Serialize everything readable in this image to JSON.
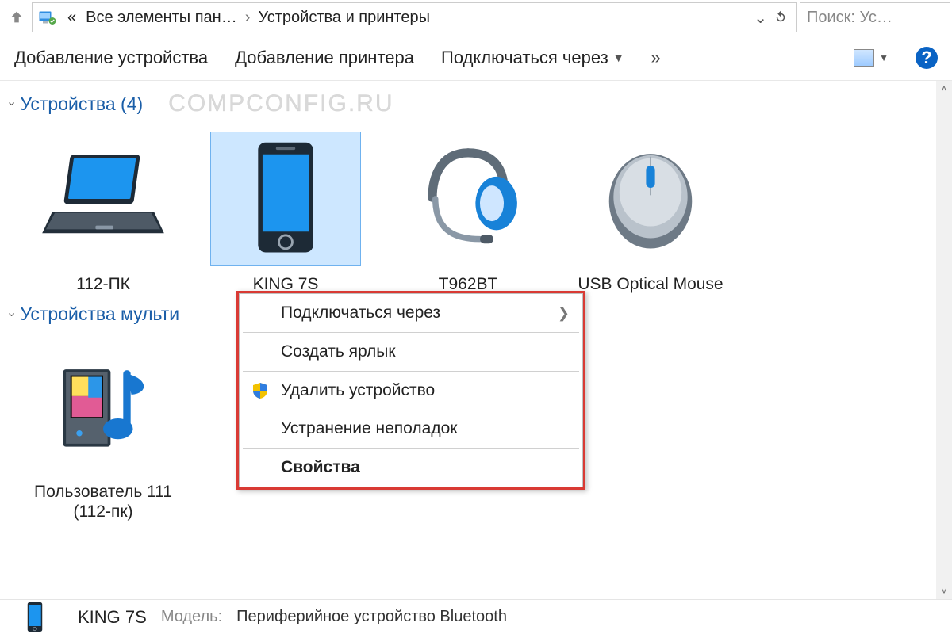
{
  "addressbar": {
    "crumb1": "Все элементы пан…",
    "crumb2": "Устройства и принтеры",
    "search_placeholder": "Поиск: Ус…"
  },
  "toolbar": {
    "add_device": "Добавление устройства",
    "add_printer": "Добавление принтера",
    "connect_via": "Подключаться через"
  },
  "groups": {
    "devices_header": "Устройства (4)",
    "multimedia_header": "Устройства мульти",
    "watermark": "COMPCONFIG.RU"
  },
  "devices": [
    {
      "label": "112-ПК"
    },
    {
      "label": "KING 7S"
    },
    {
      "label": "T962BT"
    },
    {
      "label": "USB Optical Mouse"
    }
  ],
  "multimedia": [
    {
      "label": "Пользователь 111 (112-пк)"
    }
  ],
  "context_menu": {
    "connect_via": "Подключаться через",
    "create_shortcut": "Создать ярлык",
    "remove_device": "Удалить устройство",
    "troubleshoot": "Устранение неполадок",
    "properties": "Свойства"
  },
  "details": {
    "selected_name": "KING 7S",
    "model_label": "Модель:",
    "model_value": "Периферийное устройство Bluetooth"
  }
}
